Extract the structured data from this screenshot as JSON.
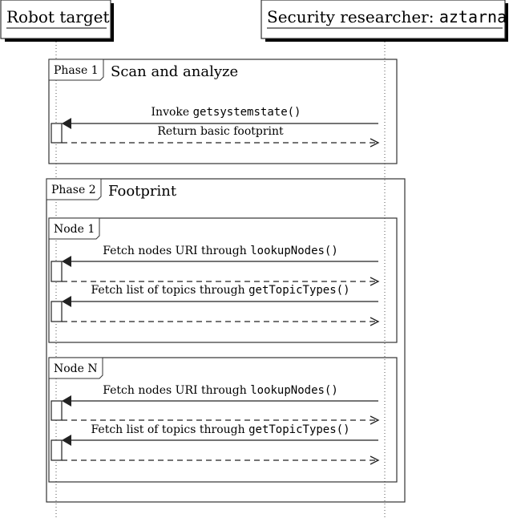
{
  "participants": [
    {
      "id": "robot",
      "label": "Robot target",
      "mono_suffix": ""
    },
    {
      "id": "researcher",
      "label": "Security researcher: ",
      "mono_suffix": "aztarna"
    }
  ],
  "fragments": [
    {
      "tag": "Phase 1",
      "title": "Scan and analyze",
      "messages": [
        {
          "text": "Invoke ",
          "code": "getsystemstate()",
          "return_text": "Return basic footprint"
        }
      ]
    },
    {
      "tag": "Phase 2",
      "title": "Footprint",
      "subfragments": [
        {
          "tag": "Node 1",
          "messages": [
            {
              "text": "Fetch nodes URI through ",
              "code": "lookupNodes()"
            },
            {
              "text": "Fetch list of topics through ",
              "code": "getTopicTypes()"
            }
          ]
        },
        {
          "tag": "Node N",
          "messages": [
            {
              "text": "Fetch nodes URI through ",
              "code": "lookupNodes()"
            },
            {
              "text": "Fetch list of topics through ",
              "code": "getTopicTypes()"
            }
          ]
        }
      ]
    }
  ]
}
